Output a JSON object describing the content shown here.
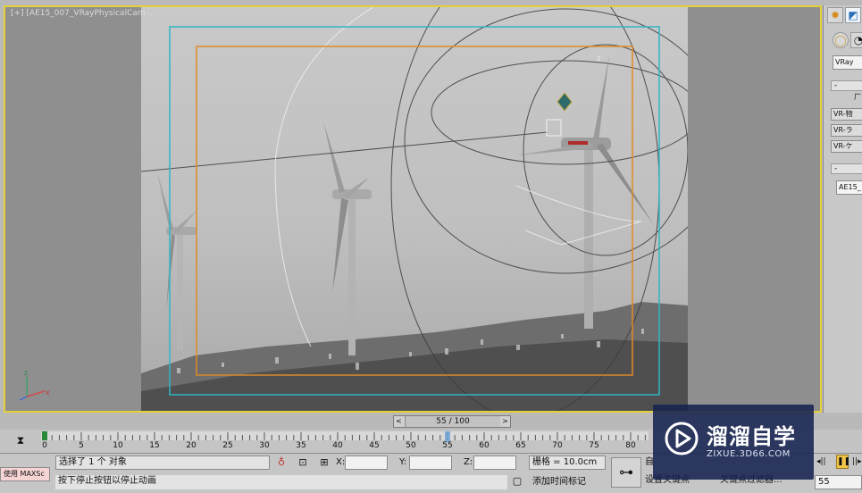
{
  "viewport": {
    "label": "[+] [AE15_007_VRayPhysicalCam...",
    "axis_z": "z",
    "axis_x": "x",
    "colors": {
      "border": "#e4cf3a",
      "safe_frame": "#2fb6c4",
      "title_safe": "#e08a2a"
    }
  },
  "command_panel": {
    "tab_icons": [
      "sun-icon",
      "camera-tab-icon"
    ],
    "renderer_dropdown": "VRay",
    "rollout_1": "-",
    "rollout_1_label": "厂",
    "buttons": [
      "VR-物",
      "VR-ラ",
      "VR-ケ"
    ],
    "rollout_2": "-",
    "name_field": "AE15_"
  },
  "time_slider": {
    "prev": "<",
    "next": ">",
    "label": "55 / 100",
    "current_frame": 55,
    "total_frames": 100
  },
  "track_bar": {
    "ticks": [
      "0",
      "5",
      "10",
      "15",
      "20",
      "25",
      "30",
      "35",
      "40",
      "45",
      "50",
      "55",
      "60",
      "65",
      "70",
      "75",
      "80"
    ],
    "current_frame": 55
  },
  "status": {
    "maxscript": "使用 MAXSc",
    "selection": "选择了 1 个 对象",
    "prompt": "按下停止按钮以停止动画",
    "x_label": "X:",
    "y_label": "Y:",
    "z_label": "Z:",
    "x_value": "",
    "y_value": "",
    "z_value": "",
    "grid": "栅格 = 10.0cm",
    "add_time_tag": "添加时间标记",
    "auto_key": "自",
    "set_key": "设置关键点",
    "key_filters": "关键点过滤器...",
    "play_field": "55"
  },
  "watermark": {
    "title": "溜溜自学",
    "url": "ZIXUE.3D66.COM"
  }
}
